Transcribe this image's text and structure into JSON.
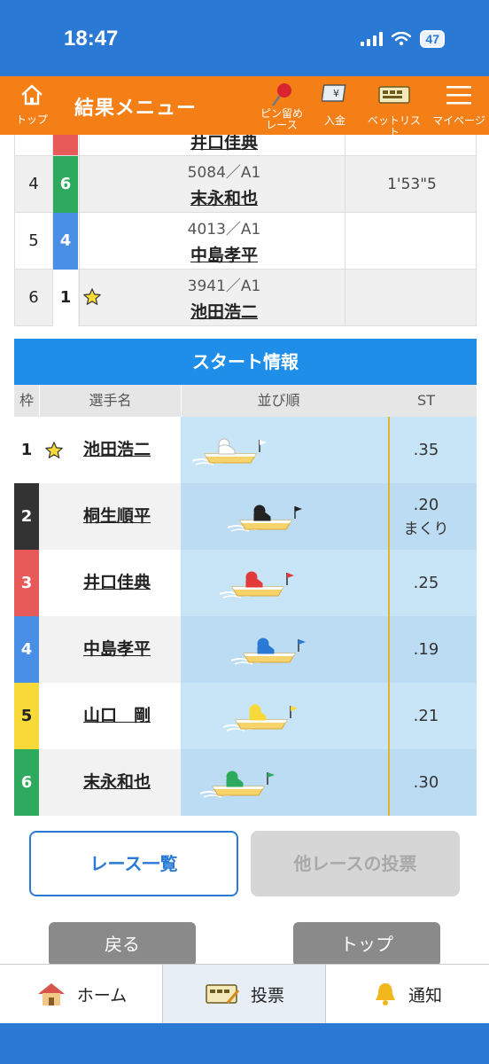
{
  "status": {
    "time": "18:47",
    "battery": "47"
  },
  "header": {
    "home_label": "トップ",
    "title": "結果メニュー",
    "pin_label_1": "ピン留め",
    "pin_label_2": "レース",
    "deposit_label": "入金",
    "betlist_label": "ベットリスト",
    "mypage_label": "マイページ"
  },
  "results": {
    "partial_name": "井口佳典",
    "rows": [
      {
        "place": "4",
        "lane": "6",
        "lane_color": "#2eaa5e",
        "reg": "5084／A1",
        "name": "末永和也",
        "time": "1'53\"5"
      },
      {
        "place": "5",
        "lane": "4",
        "lane_color": "#4a8fe6",
        "reg": "4013／A1",
        "name": "中島孝平",
        "time": ""
      },
      {
        "place": "6",
        "lane": "1",
        "lane_color": "#ffffff",
        "reg": "3941／A1",
        "name": "池田浩二",
        "time": ""
      }
    ]
  },
  "start_info": {
    "title": "スタート情報",
    "head": {
      "waku": "枠",
      "player": "選手名",
      "order": "並び順",
      "st": "ST"
    },
    "rows": [
      {
        "lane": "1",
        "name": "池田浩二",
        "st": ".35",
        "note": "",
        "lane_bg": "#ffffff",
        "lane_fg": "#222222",
        "boat_color": "#ffffff",
        "boat_offset": 0.06,
        "star": true
      },
      {
        "lane": "2",
        "name": "桐生順平",
        "st": ".20",
        "note": "まくり",
        "lane_bg": "#333333",
        "lane_fg": "#ffffff",
        "boat_color": "#222222",
        "boat_offset": 0.24,
        "star": false
      },
      {
        "lane": "3",
        "name": "井口佳典",
        "st": ".25",
        "note": "",
        "lane_bg": "#e85a5a",
        "lane_fg": "#ffffff",
        "boat_color": "#e23a3a",
        "boat_offset": 0.2,
        "star": false
      },
      {
        "lane": "4",
        "name": "中島孝平",
        "st": ".19",
        "note": "",
        "lane_bg": "#4a8fe6",
        "lane_fg": "#ffffff",
        "boat_color": "#2a7ad5",
        "boat_offset": 0.26,
        "star": false
      },
      {
        "lane": "5",
        "name": "山口　剛",
        "st": ".21",
        "note": "",
        "lane_bg": "#f7d93a",
        "lane_fg": "#222222",
        "boat_color": "#f7d93a",
        "boat_offset": 0.22,
        "star": false
      },
      {
        "lane": "6",
        "name": "末永和也",
        "st": ".30",
        "note": "",
        "lane_bg": "#2eaa5e",
        "lane_fg": "#ffffff",
        "boat_color": "#2eaa5e",
        "boat_offset": 0.1,
        "star": false
      }
    ]
  },
  "buttons": {
    "race_list": "レース一覧",
    "other_vote": "他レースの投票",
    "back": "戻る",
    "top": "トップ"
  },
  "tabbar": {
    "home": "ホーム",
    "vote": "投票",
    "notify": "通知"
  }
}
